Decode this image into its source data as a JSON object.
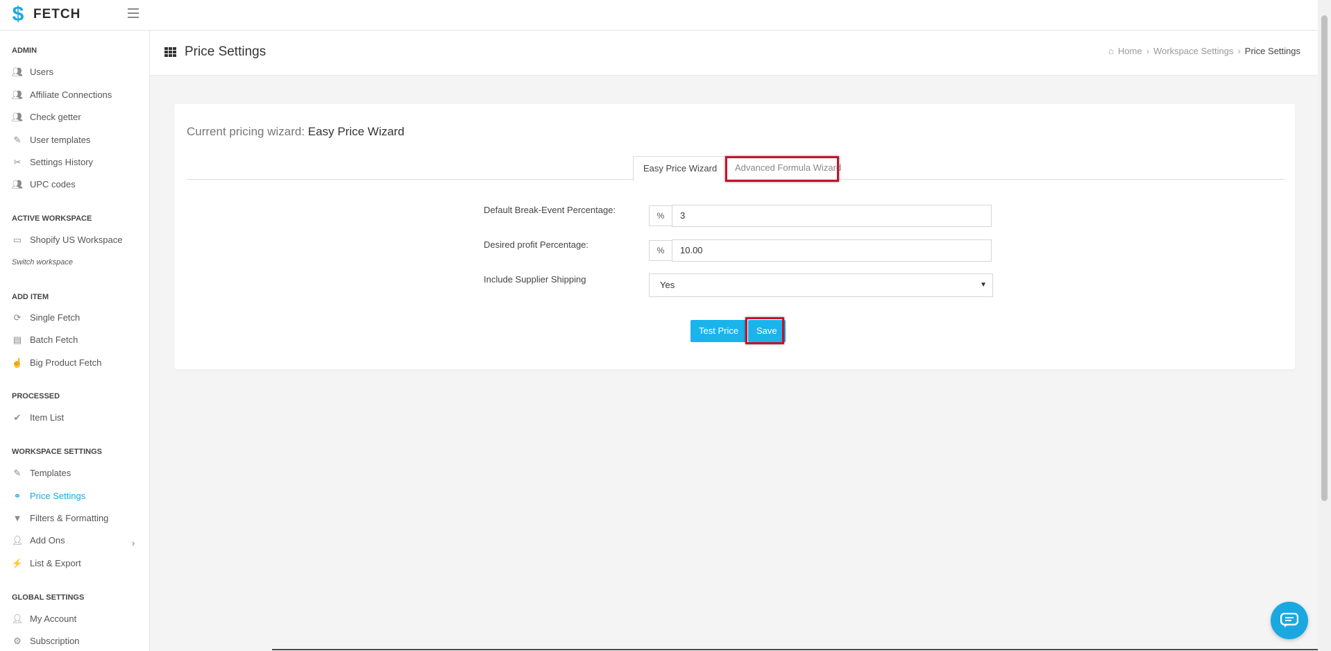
{
  "app": {
    "logo_text": "FETCH",
    "logo_mark": "$"
  },
  "sidebar": {
    "sections": [
      {
        "title": "ADMIN",
        "items": [
          {
            "label": "Users",
            "icon": "users-icon"
          },
          {
            "label": "Affiliate Connections",
            "icon": "users-icon"
          },
          {
            "label": "Check getter",
            "icon": "users-icon"
          },
          {
            "label": "User templates",
            "icon": "template-icon"
          },
          {
            "label": "Settings History",
            "icon": "history-icon"
          },
          {
            "label": "UPC codes",
            "icon": "users-icon"
          }
        ]
      },
      {
        "title": "ACTIVE WORKSPACE",
        "items": [
          {
            "label": "Shopify US Workspace",
            "icon": "monitor-icon"
          }
        ],
        "switch_label": "Switch workspace"
      },
      {
        "title": "ADD ITEM",
        "items": [
          {
            "label": "Single Fetch",
            "icon": "fetch-icon"
          },
          {
            "label": "Batch Fetch",
            "icon": "batch-icon"
          },
          {
            "label": "Big Product Fetch",
            "icon": "big-fetch-icon"
          }
        ]
      },
      {
        "title": "PROCESSED",
        "items": [
          {
            "label": "Item List",
            "icon": "checklist-icon"
          }
        ]
      },
      {
        "title": "WORKSPACE SETTINGS",
        "items": [
          {
            "label": "Templates",
            "icon": "template-icon"
          },
          {
            "label": "Price Settings",
            "icon": "price-icon"
          },
          {
            "label": "Filters & Formatting",
            "icon": "filter-icon"
          },
          {
            "label": "Add Ons",
            "icon": "addon-icon"
          },
          {
            "label": "List & Export",
            "icon": "export-icon"
          }
        ]
      },
      {
        "title": "GLOBAL SETTINGS",
        "items": [
          {
            "label": "My Account",
            "icon": "user-icon"
          },
          {
            "label": "Subscription",
            "icon": "subscription-icon"
          }
        ]
      }
    ],
    "active_item": "Price Settings"
  },
  "header": {
    "title": "Price Settings",
    "breadcrumb": [
      "Home",
      "Workspace Settings",
      "Price Settings"
    ]
  },
  "card": {
    "heading_prefix": "Current pricing wizard:",
    "heading_value": "Easy Price Wizard",
    "tabs": [
      "Easy Price Wizard",
      "Advanced Formula Wizard"
    ],
    "form": {
      "break_even_label": "Default Break-Event Percentage:",
      "break_even_addon": "%",
      "break_even_value": "3",
      "profit_label": "Desired profit Percentage:",
      "profit_addon": "%",
      "profit_value": "10.00",
      "shipping_label": "Include Supplier Shipping",
      "shipping_value": "Yes"
    },
    "buttons": {
      "test": "Test Price",
      "save": "Save"
    }
  },
  "colors": {
    "accent": "#1ab4ec",
    "highlight": "#c8102e"
  }
}
